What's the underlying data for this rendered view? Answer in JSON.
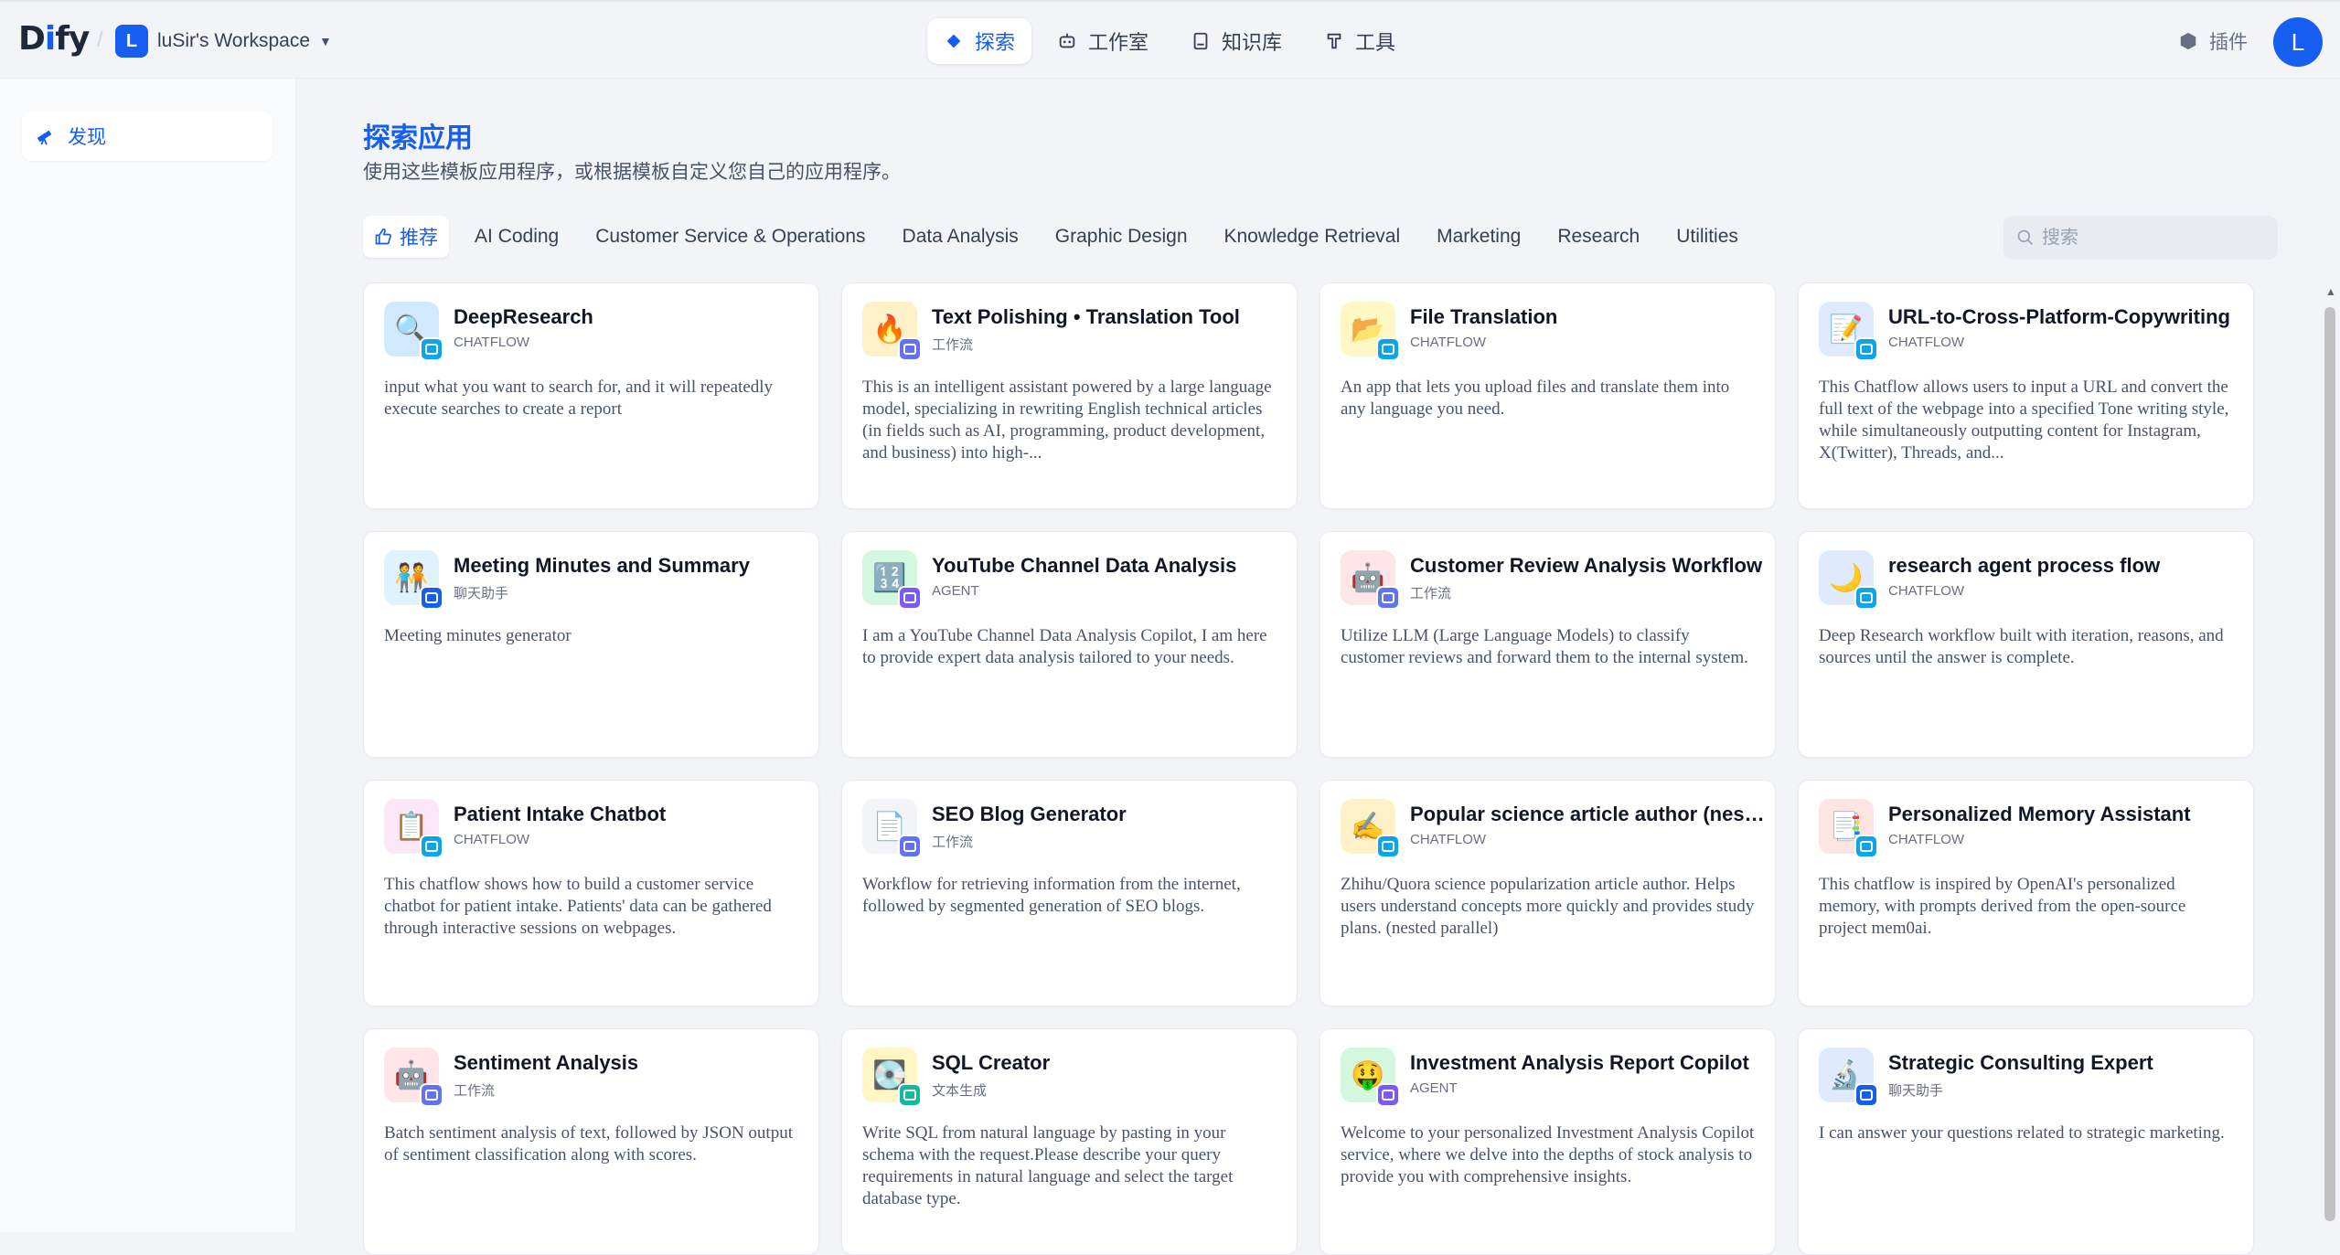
{
  "header": {
    "logo": "Dify",
    "workspace_initial": "L",
    "workspace_name": "luSir's Workspace",
    "nav": [
      {
        "label": "探索",
        "icon": "explore-icon",
        "active": true
      },
      {
        "label": "工作室",
        "icon": "robot-icon",
        "active": false
      },
      {
        "label": "知识库",
        "icon": "book-icon",
        "active": false
      },
      {
        "label": "工具",
        "icon": "hammer-icon",
        "active": false
      }
    ],
    "plugins_label": "插件",
    "avatar_initial": "L"
  },
  "sidebar": {
    "items": [
      {
        "label": "发现",
        "icon": "telescope-icon",
        "active": true
      }
    ]
  },
  "main": {
    "title": "探索应用",
    "subtitle": "使用这些模板应用程序，或根据模板自定义您自己的应用程序。",
    "filters": [
      {
        "label": "推荐",
        "active": true
      },
      {
        "label": "AI Coding"
      },
      {
        "label": "Customer Service & Operations"
      },
      {
        "label": "Data Analysis"
      },
      {
        "label": "Graphic Design"
      },
      {
        "label": "Knowledge Retrieval"
      },
      {
        "label": "Marketing"
      },
      {
        "label": "Research"
      },
      {
        "label": "Utilities"
      }
    ],
    "search_placeholder": "搜索"
  },
  "apps": [
    {
      "title": "DeepResearch",
      "type": "CHATFLOW",
      "desc": "input what you want to search for, and it will repeatedly execute searches to create a report",
      "icon_emoji": "🔍",
      "icon_bg": "#d1e9ff",
      "badge_color": "#0ba5ec"
    },
    {
      "title": "Text Polishing • Translation Tool",
      "type": "工作流",
      "desc": "This is an intelligent assistant powered by a large language model, specializing in rewriting English technical articles (in fields such as AI, programming, product development, and business) into high-...",
      "icon_emoji": "🔥",
      "icon_bg": "#fef0c7",
      "badge_color": "#6172f3"
    },
    {
      "title": "File Translation",
      "type": "CHATFLOW",
      "desc": "An app that lets you upload files and translate them into any language you need.",
      "icon_emoji": "📂",
      "icon_bg": "#fef7c3",
      "badge_color": "#0ba5ec"
    },
    {
      "title": "URL-to-Cross-Platform-Copywriting",
      "type": "CHATFLOW",
      "desc": "This Chatflow allows users to input a URL and convert the full text of the webpage into a specified Tone writing style, while simultaneously outputting content for Instagram, X(Twitter), Threads, and...",
      "icon_emoji": "📝",
      "icon_bg": "#e0eaff",
      "badge_color": "#0ba5ec"
    },
    {
      "title": "Meeting Minutes and Summary",
      "type": "聊天助手",
      "desc": "Meeting minutes generator",
      "icon_emoji": "🧑‍🤝‍🧑",
      "icon_bg": "#e0f2fe",
      "badge_color": "#155eef"
    },
    {
      "title": "YouTube Channel Data Analysis",
      "type": "AGENT",
      "desc": "I am a YouTube Channel Data Analysis Copilot, I am here to provide expert data analysis tailored to your needs.",
      "icon_emoji": "🔢",
      "icon_bg": "#d3f8df",
      "badge_color": "#7a5af8"
    },
    {
      "title": "Customer Review Analysis Workflow",
      "type": "工作流",
      "desc": "Utilize LLM (Large Language Models) to classify customer reviews and forward them to the internal system.",
      "icon_emoji": "🤖",
      "icon_bg": "#ffe4e8",
      "badge_color": "#6172f3"
    },
    {
      "title": "research agent process flow",
      "type": "CHATFLOW",
      "desc": "Deep Research workflow built with iteration, reasons, and sources until the answer is complete.",
      "icon_emoji": "🌙",
      "icon_bg": "#e0eaff",
      "badge_color": "#0ba5ec"
    },
    {
      "title": "Patient Intake Chatbot",
      "type": "CHATFLOW",
      "desc": "This chatflow shows how to build a customer service chatbot for patient intake. Patients' data can be gathered through interactive sessions on webpages.",
      "icon_emoji": "📋",
      "icon_bg": "#fce7f6",
      "badge_color": "#0ba5ec"
    },
    {
      "title": "SEO Blog Generator",
      "type": "工作流",
      "desc": "Workflow for retrieving information from the internet, followed by segmented generation of SEO blogs.",
      "icon_emoji": "📄",
      "icon_bg": "#f2f4f7",
      "badge_color": "#6172f3"
    },
    {
      "title": "Popular science article author (nested parallel)",
      "type": "CHATFLOW",
      "desc": "Zhihu/Quora science popularization article author. Helps users understand concepts more quickly and provides study plans. (nested parallel)",
      "icon_emoji": "✍️",
      "icon_bg": "#fef0c7",
      "badge_color": "#0ba5ec"
    },
    {
      "title": "Personalized Memory Assistant",
      "type": "CHATFLOW",
      "desc": "This chatflow is inspired by OpenAI's personalized memory, with prompts derived from the open-source project mem0ai.",
      "icon_emoji": "📑",
      "icon_bg": "#fee4e2",
      "badge_color": "#0ba5ec"
    },
    {
      "title": "Sentiment Analysis",
      "type": "工作流",
      "desc": "Batch sentiment analysis of text, followed by JSON output of sentiment classification along with scores.",
      "icon_emoji": "🤖",
      "icon_bg": "#ffe4e8",
      "badge_color": "#6172f3"
    },
    {
      "title": "SQL Creator",
      "type": "文本生成",
      "desc": "Write SQL from natural language by pasting in your schema with the request.Please describe your query requirements in natural language and select the target database type.",
      "icon_emoji": "💽",
      "icon_bg": "#fef7c3",
      "badge_color": "#15b79e"
    },
    {
      "title": "Investment Analysis Report Copilot",
      "type": "AGENT",
      "desc": "Welcome to your personalized Investment Analysis Copilot service, where we delve into the depths of stock analysis to provide you with comprehensive insights.",
      "icon_emoji": "🤑",
      "icon_bg": "#d3f8df",
      "badge_color": "#7a5af8"
    },
    {
      "title": "Strategic Consulting Expert",
      "type": "聊天助手",
      "desc": "I can answer your questions related to strategic marketing.",
      "icon_emoji": "🔬",
      "icon_bg": "#e0eaff",
      "badge_color": "#155eef"
    }
  ]
}
